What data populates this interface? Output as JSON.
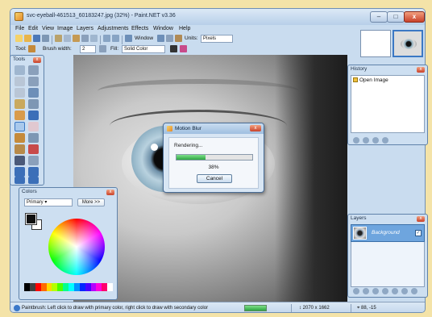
{
  "window": {
    "title": "svc-eyeball-461513_60183247.jpg (32%) - Paint.NET v3.36",
    "min_glyph": "–",
    "max_glyph": "□",
    "close_glyph": "x"
  },
  "menu": [
    "File",
    "Edit",
    "View",
    "Image",
    "Layers",
    "Adjustments",
    "Effects",
    "Window",
    "Help"
  ],
  "toolbar": {
    "window_label": "Window",
    "units_label": "Units:",
    "units_value": "Pixels",
    "tool_label": "Tool:",
    "brush_width_label": "Brush width:",
    "brush_width_value": "2",
    "fill_label": "Fill:",
    "fill_value": "Solid Color"
  },
  "tools_panel": {
    "title": "Tools",
    "close": "x"
  },
  "history_panel": {
    "title": "History",
    "close": "x",
    "items": [
      {
        "label": "Open Image",
        "icon": "image-icon"
      }
    ]
  },
  "layers_panel": {
    "title": "Layers",
    "close": "x",
    "layers": [
      {
        "name": "Background",
        "visible_glyph": "✓"
      }
    ]
  },
  "colors_panel": {
    "title": "Colors",
    "close": "x",
    "mode": "Primary",
    "more_button": "More >>",
    "primary_color": "#111111",
    "secondary_color": "#ffffff"
  },
  "dialog": {
    "title": "Motion Blur",
    "close": "x",
    "message": "Rendering...",
    "progress": 0.38,
    "progress_text": "38%",
    "cancel_label": "Cancel"
  },
  "status": {
    "hint": "Paintbrush: Left click to draw with primary color, right click to draw with secondary color",
    "image_size": "2070 x 1662",
    "cursor_pos": "88, -15"
  }
}
